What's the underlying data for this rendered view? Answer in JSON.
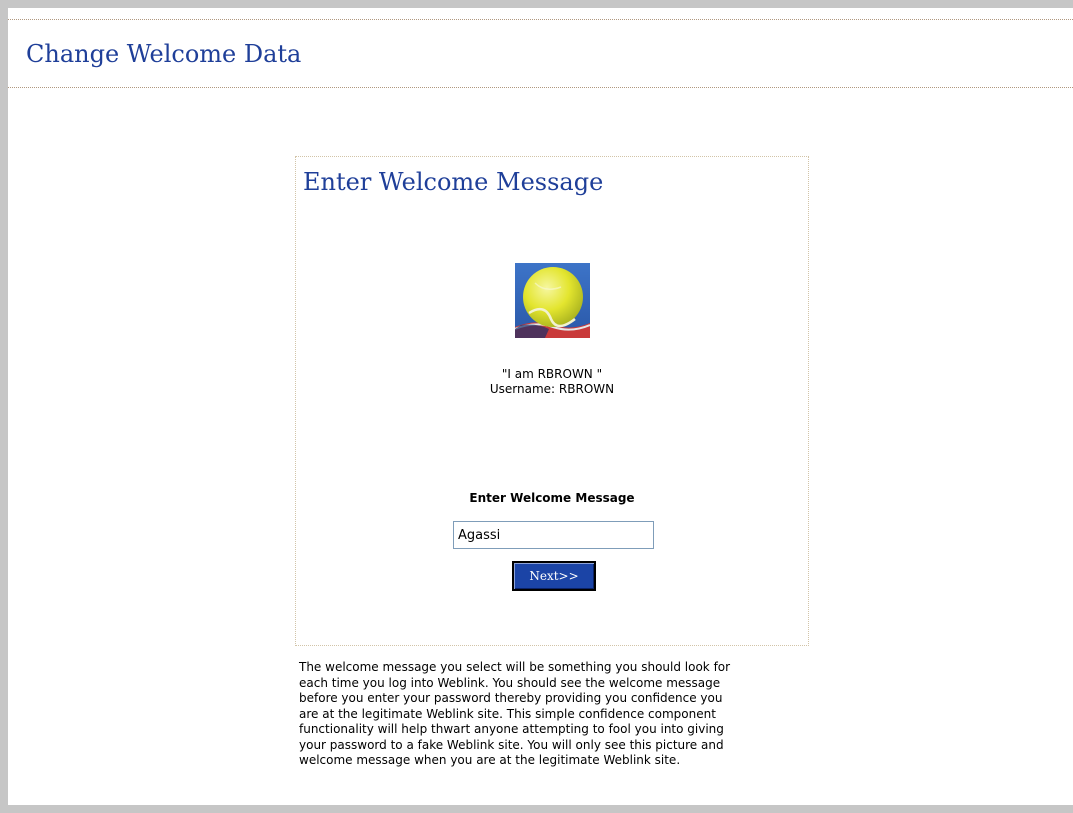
{
  "page": {
    "title": "Change Welcome Data"
  },
  "panel": {
    "title": "Enter Welcome Message",
    "avatar_description": "tennis-ball-picture",
    "identity_quote": "\"I am RBROWN \"",
    "identity_username": "Username: RBROWN",
    "field_label": "Enter Welcome Message",
    "message_value": "Agassi",
    "next_label": "Next>>"
  },
  "help": {
    "lines": [
      "The welcome message you select will be something you should look for",
      "each time you log into Weblink. You should see the welcome message",
      "before you enter your password thereby providing you confidence you",
      "are at the legitimate Weblink site. This simple confidence component",
      "functionality will help thwart anyone attempting to fool you into giving",
      "your password to a fake Weblink site. You will only see this picture and",
      "welcome message when you are at the legitimate Weblink site."
    ]
  },
  "colors": {
    "title_blue": "#1f3f99",
    "button_blue": "#1b44a6",
    "frame_gray": "#c6c6c6",
    "rule_tan": "#b09880"
  }
}
